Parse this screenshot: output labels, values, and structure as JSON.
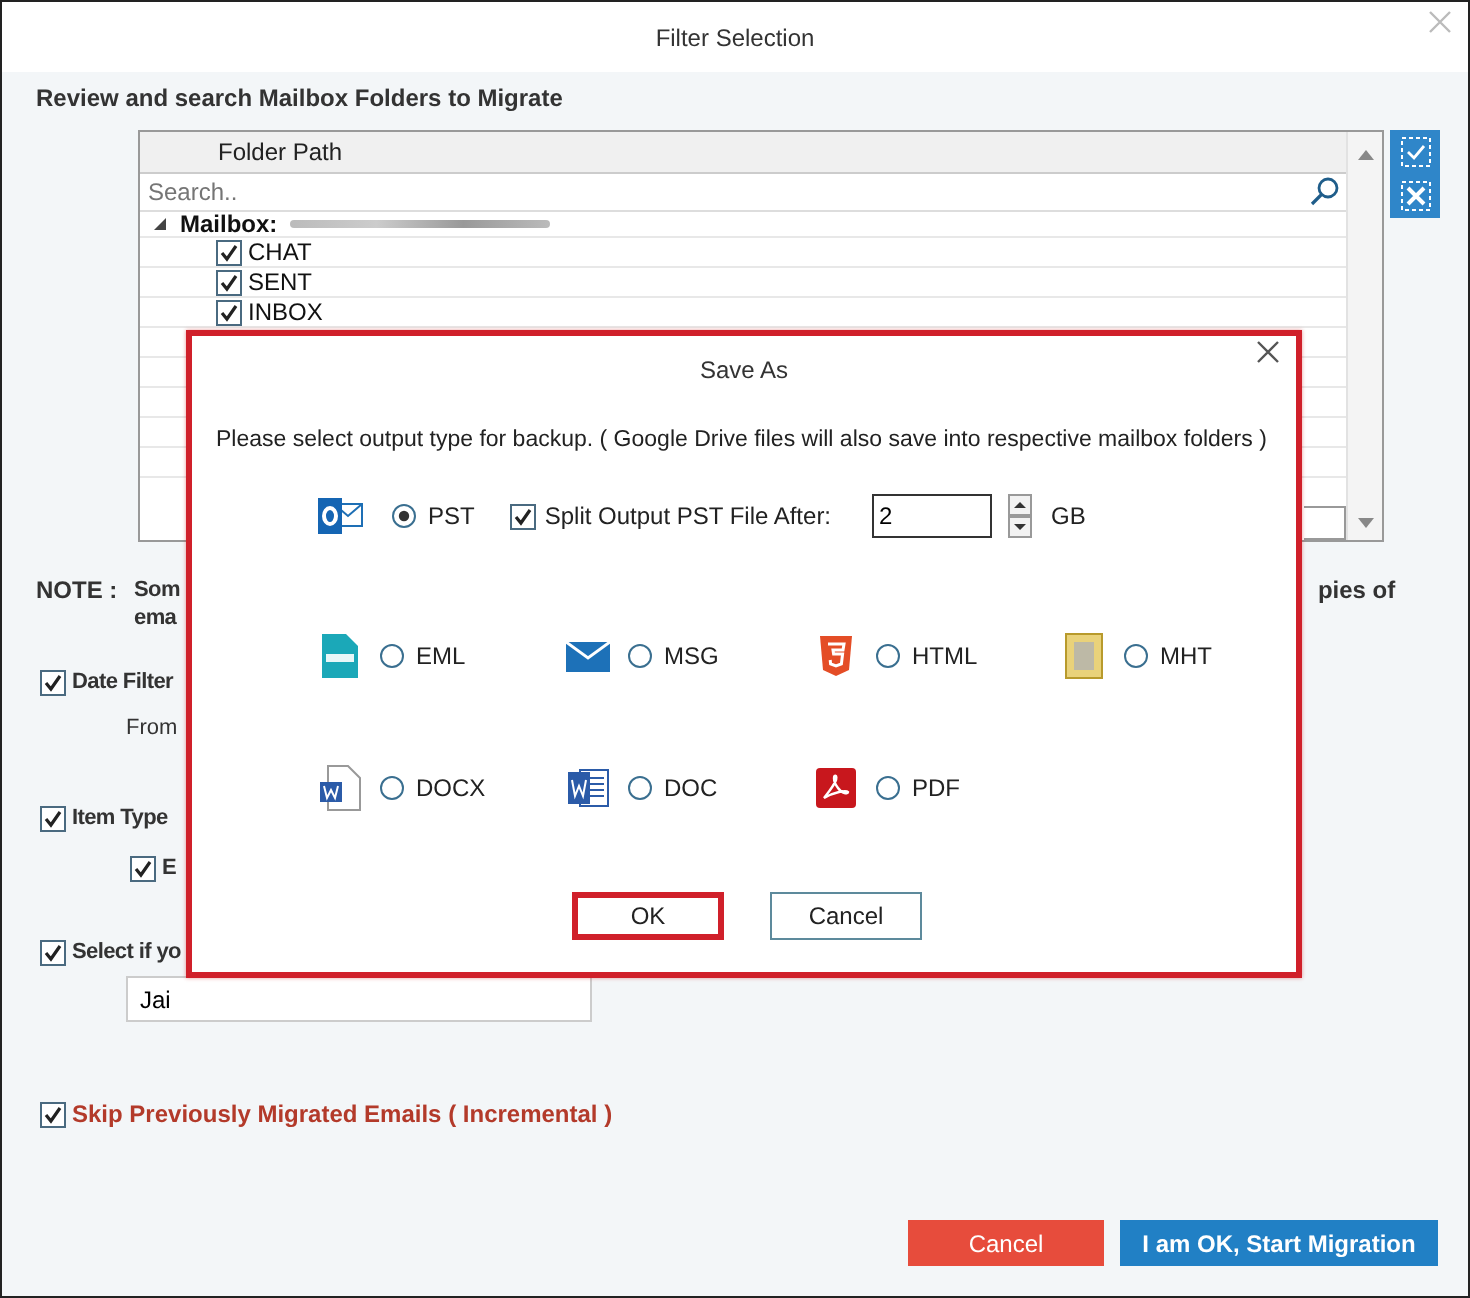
{
  "window": {
    "title": "Filter Selection"
  },
  "heading": "Review and search Mailbox Folders to Migrate",
  "folder_table": {
    "columns": [
      "Folder Path"
    ],
    "search": {
      "placeholder": "Search.."
    },
    "root": {
      "label": "Mailbox:",
      "expanded": true,
      "children": [
        {
          "label": "CHAT",
          "checked": true
        },
        {
          "label": "SENT",
          "checked": true
        },
        {
          "label": "INBOX",
          "checked": true
        }
      ]
    }
  },
  "note": {
    "label": "NOTE :",
    "line_1_start": "Som",
    "line_1_end": "pies of",
    "line_2_start": "ema"
  },
  "filters": [
    {
      "kind": "checkbox",
      "label": "Date Filter",
      "checked": true
    },
    {
      "kind": "text",
      "label": "From"
    },
    {
      "kind": "checkbox",
      "label": "Item Type",
      "checked": true
    },
    {
      "kind": "subcheckbox",
      "label": "E",
      "checked": true
    },
    {
      "kind": "checkbox",
      "label": "Select if yo",
      "checked": true
    },
    {
      "kind": "field",
      "value": "Jai"
    },
    {
      "kind": "warning",
      "label": "Skip Previously Migrated Emails ( Incremental )",
      "checked": true
    }
  ],
  "save_as": {
    "title": "Save As",
    "highlighted": true,
    "description": "Please select output type for backup. ( Google Drive files will also save into respective mailbox folders )",
    "split": {
      "label": "Split Output PST File After:",
      "checked": true,
      "value": "2",
      "unit": "GB"
    },
    "formats": [
      {
        "kind": "pst",
        "label": "PST",
        "selected": true
      },
      {
        "kind": "eml",
        "label": "EML",
        "selected": false
      },
      {
        "kind": "msg",
        "label": "MSG",
        "selected": false
      },
      {
        "kind": "html",
        "label": "HTML",
        "selected": false
      },
      {
        "kind": "mht",
        "label": "MHT",
        "selected": false
      },
      {
        "kind": "docx",
        "label": "DOCX",
        "selected": false
      },
      {
        "kind": "doc",
        "label": "DOC",
        "selected": false
      },
      {
        "kind": "pdf",
        "label": "PDF",
        "selected": false
      }
    ],
    "buttons": [
      {
        "label": "OK",
        "highlighted": true
      },
      {
        "label": "Cancel",
        "highlighted": false
      }
    ]
  },
  "footer_buttons": [
    {
      "kind": "danger",
      "label": "Cancel"
    },
    {
      "kind": "primary",
      "label": "I am OK, Start Migration"
    }
  ]
}
